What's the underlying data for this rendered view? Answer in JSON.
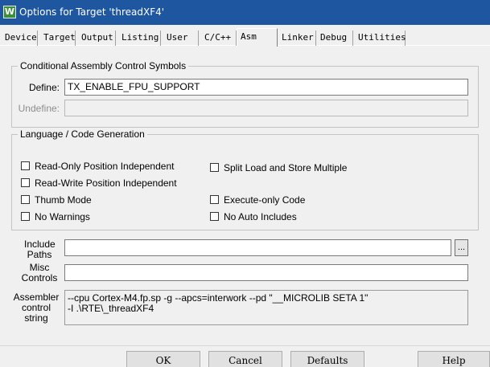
{
  "window": {
    "icon_glyph": "W",
    "title": "Options for Target 'threadXF4'",
    "titlebar_color": "#1e56a0"
  },
  "tabs": [
    {
      "label": "Device"
    },
    {
      "label": "Target"
    },
    {
      "label": "Output"
    },
    {
      "label": "Listing"
    },
    {
      "label": "User"
    },
    {
      "label": "C/C++"
    },
    {
      "label": "Asm",
      "active": true
    },
    {
      "label": "Linker"
    },
    {
      "label": "Debug"
    },
    {
      "label": "Utilities"
    }
  ],
  "conditional": {
    "legend": "Conditional Assembly Control Symbols",
    "define_label": "Define:",
    "define_value": "TX_ENABLE_FPU_SUPPORT",
    "undefine_label": "Undefine:",
    "undefine_value": ""
  },
  "language": {
    "legend": "Language / Code Generation",
    "options": [
      {
        "label": "Read-Only Position Independent",
        "checked": false
      },
      {
        "label": "Read-Write Position Independent",
        "checked": false
      },
      {
        "label": "Thumb Mode",
        "checked": false
      },
      {
        "label": "No Warnings",
        "checked": false
      },
      {
        "label": "Split Load and Store Multiple",
        "checked": false
      },
      {
        "label": "Execute-only Code",
        "checked": false
      },
      {
        "label": "No Auto Includes",
        "checked": false
      }
    ]
  },
  "include_paths": {
    "label_line1": "Include",
    "label_line2": "Paths",
    "value": "",
    "browse_label": "..."
  },
  "misc_controls": {
    "label_line1": "Misc",
    "label_line2": "Controls",
    "value": ""
  },
  "assembler_control": {
    "label_line1": "Assembler",
    "label_line2": "control",
    "label_line3": "string",
    "lines": [
      "--cpu Cortex-M4.fp.sp -g --apcs=interwork --pd \"__MICROLIB SETA 1\"",
      "-I .\\RTE\\_threadXF4"
    ]
  },
  "buttons": {
    "ok": "OK",
    "cancel": "Cancel",
    "defaults": "Defaults",
    "help": "Help"
  }
}
